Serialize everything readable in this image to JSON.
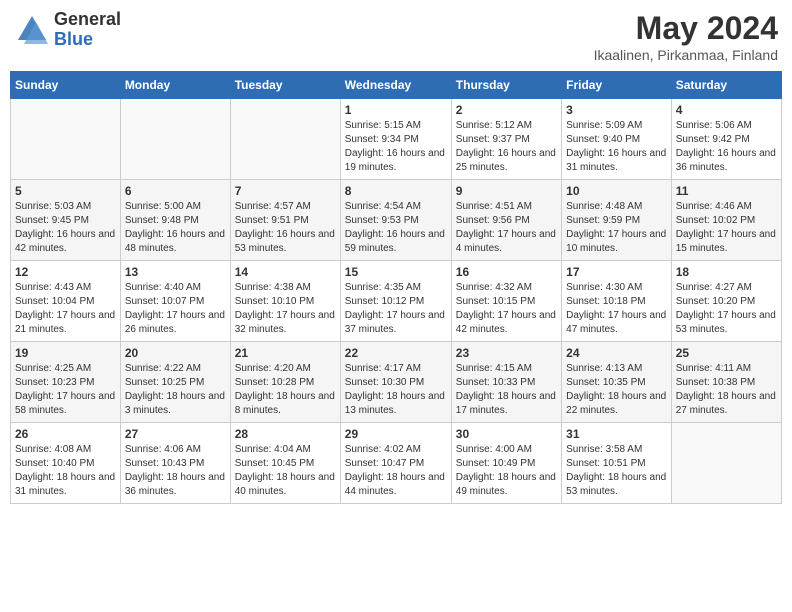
{
  "header": {
    "logo_general": "General",
    "logo_blue": "Blue",
    "title": "May 2024",
    "location": "Ikaalinen, Pirkanmaa, Finland"
  },
  "days_of_week": [
    "Sunday",
    "Monday",
    "Tuesday",
    "Wednesday",
    "Thursday",
    "Friday",
    "Saturday"
  ],
  "weeks": [
    [
      {
        "day": "",
        "info": ""
      },
      {
        "day": "",
        "info": ""
      },
      {
        "day": "",
        "info": ""
      },
      {
        "day": "1",
        "info": "Sunrise: 5:15 AM\nSunset: 9:34 PM\nDaylight: 16 hours and 19 minutes."
      },
      {
        "day": "2",
        "info": "Sunrise: 5:12 AM\nSunset: 9:37 PM\nDaylight: 16 hours and 25 minutes."
      },
      {
        "day": "3",
        "info": "Sunrise: 5:09 AM\nSunset: 9:40 PM\nDaylight: 16 hours and 31 minutes."
      },
      {
        "day": "4",
        "info": "Sunrise: 5:06 AM\nSunset: 9:42 PM\nDaylight: 16 hours and 36 minutes."
      }
    ],
    [
      {
        "day": "5",
        "info": "Sunrise: 5:03 AM\nSunset: 9:45 PM\nDaylight: 16 hours and 42 minutes."
      },
      {
        "day": "6",
        "info": "Sunrise: 5:00 AM\nSunset: 9:48 PM\nDaylight: 16 hours and 48 minutes."
      },
      {
        "day": "7",
        "info": "Sunrise: 4:57 AM\nSunset: 9:51 PM\nDaylight: 16 hours and 53 minutes."
      },
      {
        "day": "8",
        "info": "Sunrise: 4:54 AM\nSunset: 9:53 PM\nDaylight: 16 hours and 59 minutes."
      },
      {
        "day": "9",
        "info": "Sunrise: 4:51 AM\nSunset: 9:56 PM\nDaylight: 17 hours and 4 minutes."
      },
      {
        "day": "10",
        "info": "Sunrise: 4:48 AM\nSunset: 9:59 PM\nDaylight: 17 hours and 10 minutes."
      },
      {
        "day": "11",
        "info": "Sunrise: 4:46 AM\nSunset: 10:02 PM\nDaylight: 17 hours and 15 minutes."
      }
    ],
    [
      {
        "day": "12",
        "info": "Sunrise: 4:43 AM\nSunset: 10:04 PM\nDaylight: 17 hours and 21 minutes."
      },
      {
        "day": "13",
        "info": "Sunrise: 4:40 AM\nSunset: 10:07 PM\nDaylight: 17 hours and 26 minutes."
      },
      {
        "day": "14",
        "info": "Sunrise: 4:38 AM\nSunset: 10:10 PM\nDaylight: 17 hours and 32 minutes."
      },
      {
        "day": "15",
        "info": "Sunrise: 4:35 AM\nSunset: 10:12 PM\nDaylight: 17 hours and 37 minutes."
      },
      {
        "day": "16",
        "info": "Sunrise: 4:32 AM\nSunset: 10:15 PM\nDaylight: 17 hours and 42 minutes."
      },
      {
        "day": "17",
        "info": "Sunrise: 4:30 AM\nSunset: 10:18 PM\nDaylight: 17 hours and 47 minutes."
      },
      {
        "day": "18",
        "info": "Sunrise: 4:27 AM\nSunset: 10:20 PM\nDaylight: 17 hours and 53 minutes."
      }
    ],
    [
      {
        "day": "19",
        "info": "Sunrise: 4:25 AM\nSunset: 10:23 PM\nDaylight: 17 hours and 58 minutes."
      },
      {
        "day": "20",
        "info": "Sunrise: 4:22 AM\nSunset: 10:25 PM\nDaylight: 18 hours and 3 minutes."
      },
      {
        "day": "21",
        "info": "Sunrise: 4:20 AM\nSunset: 10:28 PM\nDaylight: 18 hours and 8 minutes."
      },
      {
        "day": "22",
        "info": "Sunrise: 4:17 AM\nSunset: 10:30 PM\nDaylight: 18 hours and 13 minutes."
      },
      {
        "day": "23",
        "info": "Sunrise: 4:15 AM\nSunset: 10:33 PM\nDaylight: 18 hours and 17 minutes."
      },
      {
        "day": "24",
        "info": "Sunrise: 4:13 AM\nSunset: 10:35 PM\nDaylight: 18 hours and 22 minutes."
      },
      {
        "day": "25",
        "info": "Sunrise: 4:11 AM\nSunset: 10:38 PM\nDaylight: 18 hours and 27 minutes."
      }
    ],
    [
      {
        "day": "26",
        "info": "Sunrise: 4:08 AM\nSunset: 10:40 PM\nDaylight: 18 hours and 31 minutes."
      },
      {
        "day": "27",
        "info": "Sunrise: 4:06 AM\nSunset: 10:43 PM\nDaylight: 18 hours and 36 minutes."
      },
      {
        "day": "28",
        "info": "Sunrise: 4:04 AM\nSunset: 10:45 PM\nDaylight: 18 hours and 40 minutes."
      },
      {
        "day": "29",
        "info": "Sunrise: 4:02 AM\nSunset: 10:47 PM\nDaylight: 18 hours and 44 minutes."
      },
      {
        "day": "30",
        "info": "Sunrise: 4:00 AM\nSunset: 10:49 PM\nDaylight: 18 hours and 49 minutes."
      },
      {
        "day": "31",
        "info": "Sunrise: 3:58 AM\nSunset: 10:51 PM\nDaylight: 18 hours and 53 minutes."
      },
      {
        "day": "",
        "info": ""
      }
    ]
  ]
}
